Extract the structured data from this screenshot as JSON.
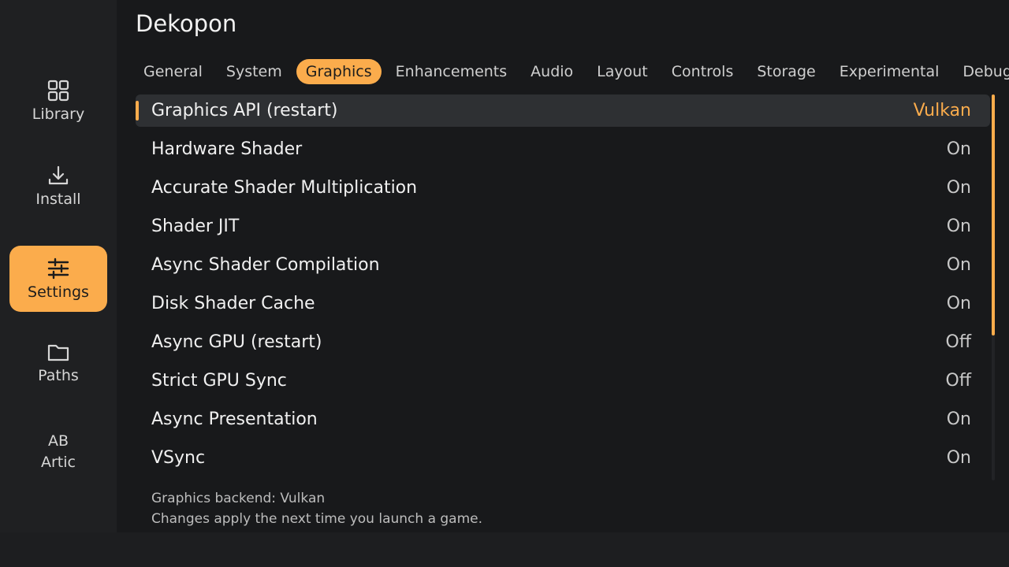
{
  "app": {
    "title": "Dekopon",
    "accent_color": "#fbac4c"
  },
  "sidebar": {
    "items": [
      {
        "label": "Library",
        "icon": "grid-icon",
        "active": false
      },
      {
        "label": "Install",
        "icon": "download-icon",
        "active": false
      },
      {
        "label": "Settings",
        "icon": "sliders-icon",
        "active": true
      },
      {
        "label": "Paths",
        "icon": "folder-icon",
        "active": false
      },
      {
        "label": "Artic",
        "icon_text": "AB",
        "active": false
      }
    ]
  },
  "tabs": [
    {
      "label": "General",
      "active": false
    },
    {
      "label": "System",
      "active": false
    },
    {
      "label": "Graphics",
      "active": true
    },
    {
      "label": "Enhancements",
      "active": false
    },
    {
      "label": "Audio",
      "active": false
    },
    {
      "label": "Layout",
      "active": false
    },
    {
      "label": "Controls",
      "active": false
    },
    {
      "label": "Storage",
      "active": false
    },
    {
      "label": "Experimental",
      "active": false
    },
    {
      "label": "Debug",
      "active": false
    }
  ],
  "settings": [
    {
      "label": "Graphics API (restart)",
      "value": "Vulkan",
      "selected": true
    },
    {
      "label": "Hardware Shader",
      "value": "On",
      "selected": false
    },
    {
      "label": "Accurate Shader Multiplication",
      "value": "On",
      "selected": false
    },
    {
      "label": "Shader JIT",
      "value": "On",
      "selected": false
    },
    {
      "label": "Async Shader Compilation",
      "value": "On",
      "selected": false
    },
    {
      "label": "Disk Shader Cache",
      "value": "On",
      "selected": false
    },
    {
      "label": "Async GPU (restart)",
      "value": "Off",
      "selected": false
    },
    {
      "label": "Strict GPU Sync",
      "value": "Off",
      "selected": false
    },
    {
      "label": "Async Presentation",
      "value": "On",
      "selected": false
    },
    {
      "label": "VSync",
      "value": "On",
      "selected": false
    }
  ],
  "description": {
    "line1": "Graphics backend: Vulkan",
    "line2": "Changes apply the next time you launch a game."
  }
}
